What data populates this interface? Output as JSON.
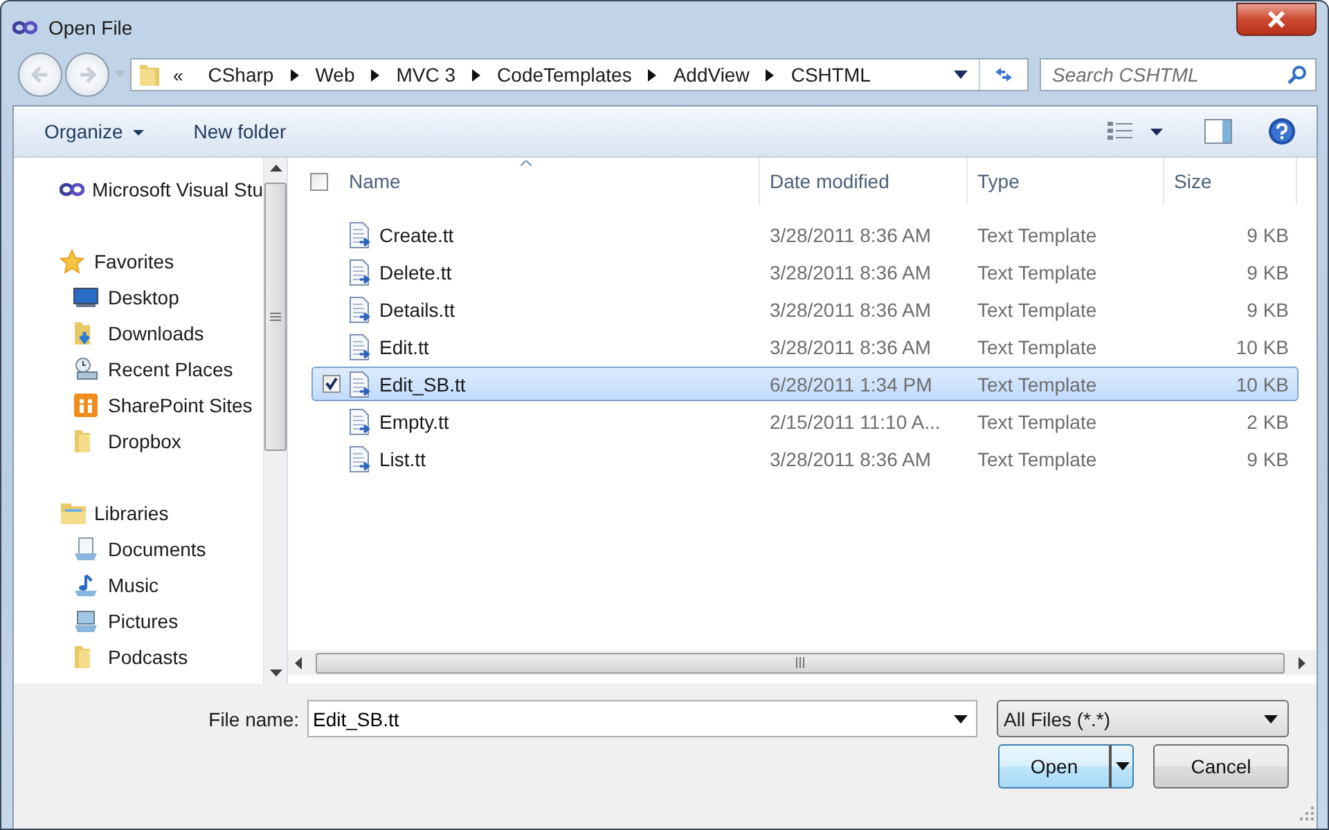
{
  "window": {
    "title": "Open File"
  },
  "address": {
    "overflow": "«",
    "crumbs": [
      "CSharp",
      "Web",
      "MVC 3",
      "CodeTemplates",
      "AddView",
      "CSHTML"
    ]
  },
  "search": {
    "placeholder": "Search CSHTML"
  },
  "toolbar": {
    "organize": "Organize",
    "new_folder": "New folder"
  },
  "nav": [
    {
      "label": "Microsoft Visual Stu",
      "kind": "vs"
    },
    {
      "label": "Favorites",
      "kind": "star",
      "children": [
        {
          "label": "Desktop",
          "kind": "desktop"
        },
        {
          "label": "Downloads",
          "kind": "downloads"
        },
        {
          "label": "Recent Places",
          "kind": "recent"
        },
        {
          "label": "SharePoint Sites",
          "kind": "sharepoint"
        },
        {
          "label": "Dropbox",
          "kind": "folder"
        }
      ]
    },
    {
      "label": "Libraries",
      "kind": "libraries",
      "children": [
        {
          "label": "Documents",
          "kind": "documents"
        },
        {
          "label": "Music",
          "kind": "music"
        },
        {
          "label": "Pictures",
          "kind": "pictures"
        },
        {
          "label": "Podcasts",
          "kind": "folder"
        }
      ]
    }
  ],
  "table": {
    "select_all_checked": false,
    "columns": [
      {
        "label": "Name",
        "sorted": true
      },
      {
        "label": "Date modified",
        "sorted": false
      },
      {
        "label": "Type",
        "sorted": false
      },
      {
        "label": "Size",
        "sorted": false
      }
    ],
    "rows": [
      {
        "name": "Create.tt",
        "date": "3/28/2011 8:36 AM",
        "type": "Text Template",
        "size": "9 KB",
        "selected": false
      },
      {
        "name": "Delete.tt",
        "date": "3/28/2011 8:36 AM",
        "type": "Text Template",
        "size": "9 KB",
        "selected": false
      },
      {
        "name": "Details.tt",
        "date": "3/28/2011 8:36 AM",
        "type": "Text Template",
        "size": "9 KB",
        "selected": false
      },
      {
        "name": "Edit.tt",
        "date": "3/28/2011 8:36 AM",
        "type": "Text Template",
        "size": "10 KB",
        "selected": false
      },
      {
        "name": "Edit_SB.tt",
        "date": "6/28/2011 1:34 PM",
        "type": "Text Template",
        "size": "10 KB",
        "selected": true
      },
      {
        "name": "Empty.tt",
        "date": "2/15/2011 11:10 A...",
        "type": "Text Template",
        "size": "2 KB",
        "selected": false
      },
      {
        "name": "List.tt",
        "date": "3/28/2011 8:36 AM",
        "type": "Text Template",
        "size": "9 KB",
        "selected": false
      }
    ]
  },
  "file_name": {
    "label": "File name:",
    "value": "Edit_SB.tt"
  },
  "filter": {
    "value": "All Files (*.*)"
  },
  "buttons": {
    "open": "Open",
    "cancel": "Cancel"
  }
}
